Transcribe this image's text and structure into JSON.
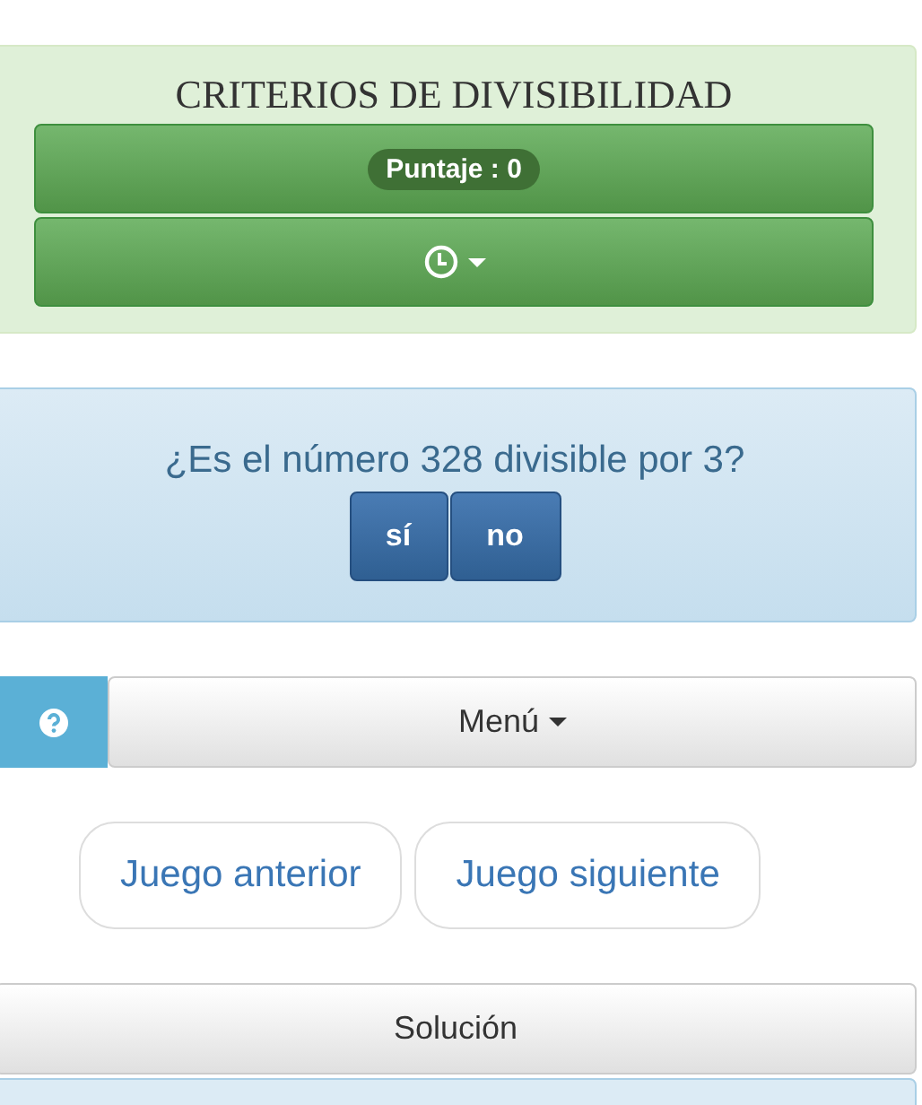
{
  "header": {
    "title": "CRITERIOS DE DIVISIBILIDAD",
    "score": "Puntaje : 0"
  },
  "question": {
    "text": "¿Es el número 328 divisible por 3?",
    "answers": [
      "sí",
      "no"
    ]
  },
  "menu": {
    "label": "Menú"
  },
  "navigation": [
    "Juego anterior",
    "Juego siguiente"
  ],
  "solution": {
    "label": "Solución"
  }
}
